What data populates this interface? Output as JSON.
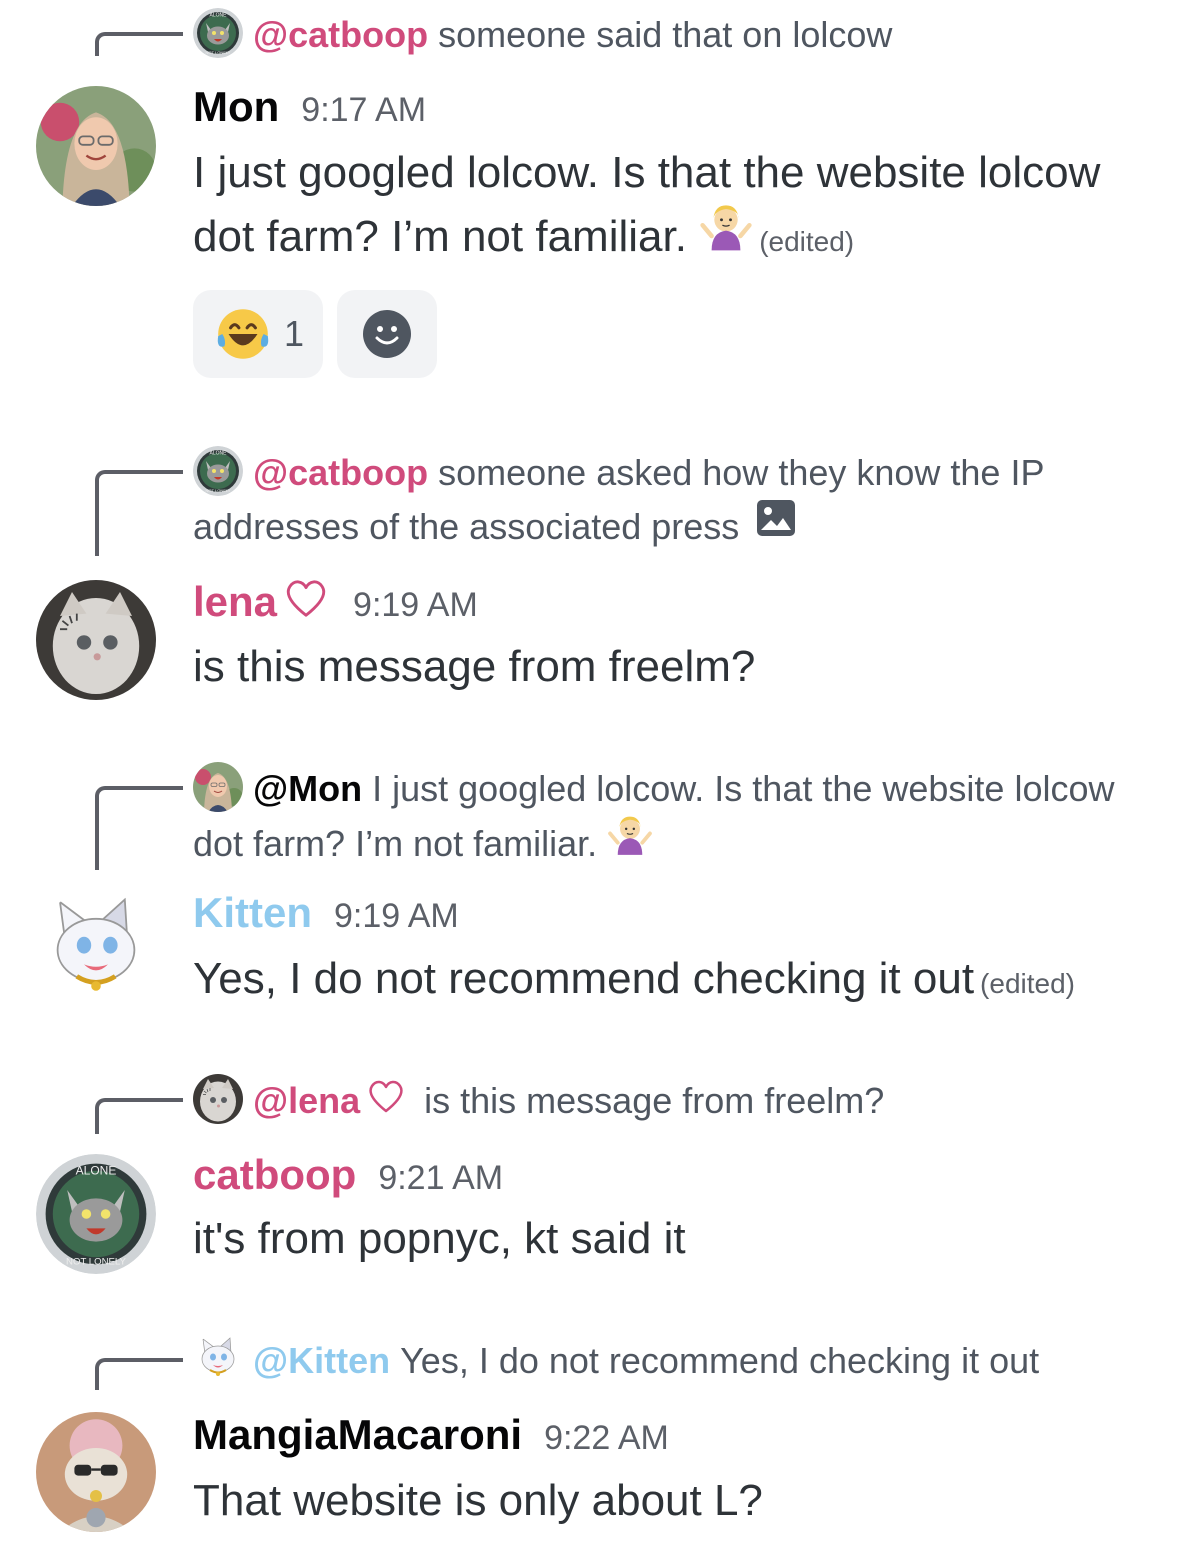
{
  "colors": {
    "catboop": "#d04b7c",
    "mon": "#060607",
    "lena": "#d04b7c",
    "kitten": "#8fcaee",
    "mangia": "#060607"
  },
  "messages": [
    {
      "reply_mention": "@catboop",
      "reply_text": "someone said that on lolcow",
      "author": "Mon",
      "time": "9:17 AM",
      "text": "I just googled lolcow. Is that the website lolcow dot farm? I’m not familiar.",
      "edited": "(edited)",
      "reactions": [
        {
          "emoji": "laughing-tears-emoji",
          "count": "1"
        },
        {
          "emoji": "add-reaction-icon"
        }
      ]
    },
    {
      "reply_mention": "@catboop",
      "reply_text": "someone asked how they know the IP addresses of the associated press",
      "author": "lena",
      "time": "9:19 AM",
      "text": "is this message from freelm?"
    },
    {
      "reply_mention": "@Mon",
      "reply_text": "I just googled lolcow. Is that the website lolcow dot farm? I’m not familiar.",
      "author": "Kitten",
      "time": "9:19 AM",
      "text": "Yes, I do not recommend checking it out",
      "edited": "(edited)"
    },
    {
      "reply_mention": "@lena",
      "reply_text": "is this message from freelm?",
      "author": "catboop",
      "time": "9:21 AM",
      "text": "it's from popnyc, kt said it"
    },
    {
      "reply_mention": "@Kitten",
      "reply_text": "Yes, I do not recommend checking it out",
      "author": "MangiaMacaroni",
      "time": "9:22 AM",
      "text": "That website is only about L?"
    }
  ]
}
